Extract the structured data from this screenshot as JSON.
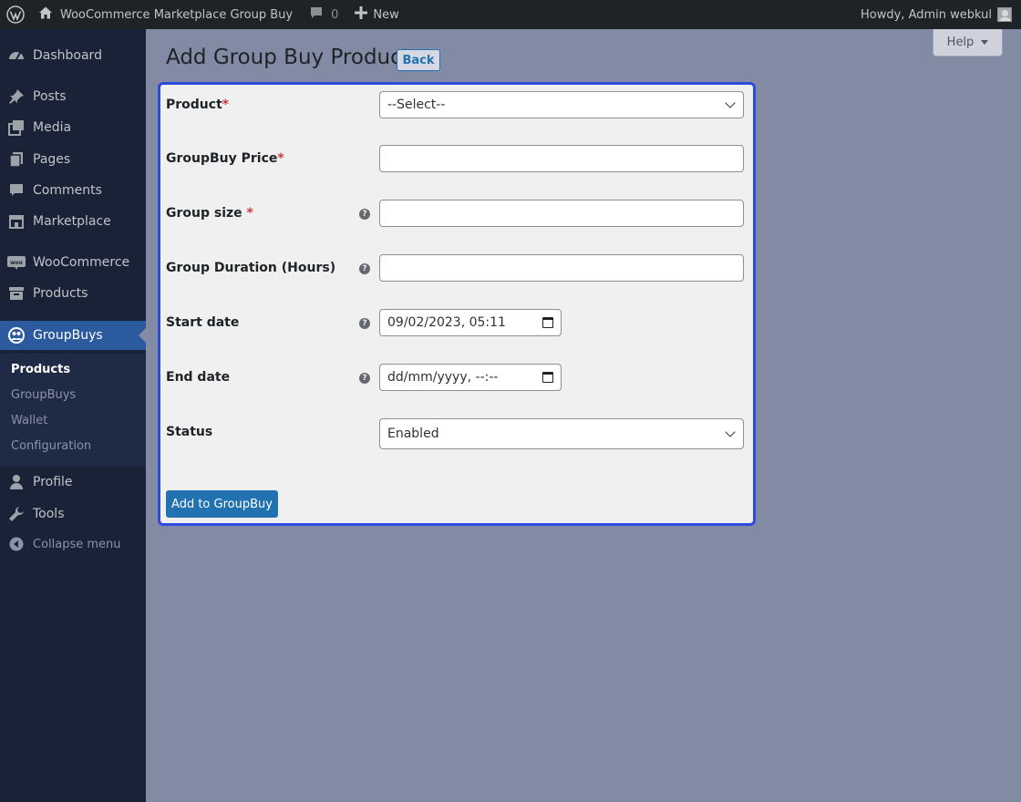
{
  "adminbar": {
    "site_name": "WooCommerce Marketplace Group Buy",
    "comments_count": "0",
    "new_label": "New",
    "greeting": "Howdy, Admin webkul"
  },
  "sidebar": {
    "items": [
      {
        "label": "Dashboard",
        "icon": "dashboard-icon"
      },
      {
        "label": "Posts",
        "icon": "pin-icon"
      },
      {
        "label": "Media",
        "icon": "media-icon"
      },
      {
        "label": "Pages",
        "icon": "pages-icon"
      },
      {
        "label": "Comments",
        "icon": "comment-icon"
      },
      {
        "label": "Marketplace",
        "icon": "store-icon"
      },
      {
        "label": "WooCommerce",
        "icon": "woo-icon"
      },
      {
        "label": "Products",
        "icon": "archive-icon"
      },
      {
        "label": "GroupBuys",
        "icon": "groupbuy-icon"
      },
      {
        "label": "Profile",
        "icon": "user-icon"
      },
      {
        "label": "Tools",
        "icon": "wrench-icon"
      }
    ],
    "submenu": [
      "Products",
      "GroupBuys",
      "Wallet",
      "Configuration"
    ],
    "collapse_label": "Collapse menu"
  },
  "help_label": "Help",
  "page": {
    "title": "Add Group Buy Product",
    "back_label": "Back"
  },
  "form": {
    "product_label": "Product",
    "product_value": "--Select--",
    "price_label": "GroupBuy Price",
    "size_label": "Group size ",
    "duration_label": "Group Duration (Hours)",
    "start_label": "Start date",
    "start_value": "09/02/2023, 05:11",
    "end_label": "End date",
    "end_value": "dd/mm/yyyy, --:--",
    "status_label": "Status",
    "status_value": "Enabled",
    "required_mark": "*",
    "help_glyph": "?",
    "submit_label": "Add to GroupBuy"
  },
  "colors": {
    "accent": "#2271b1",
    "panel_border": "#2d4bdc",
    "required": "#d63638"
  }
}
